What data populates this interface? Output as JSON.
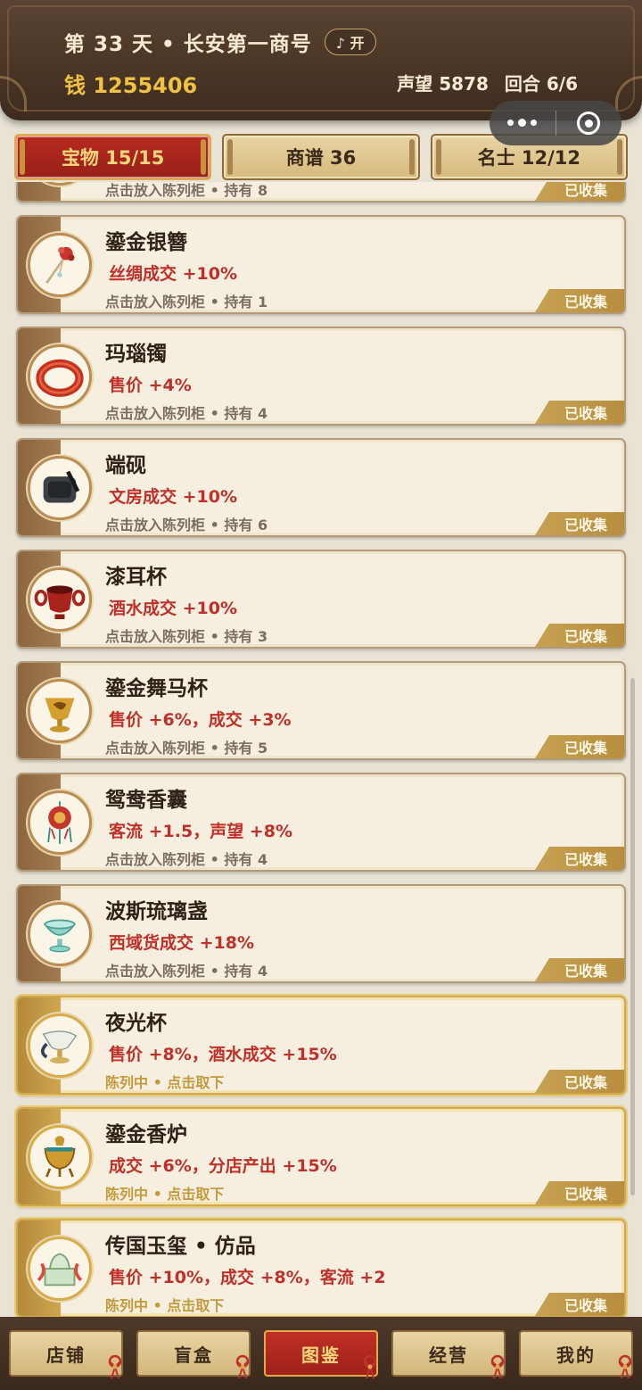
{
  "header": {
    "title": "第 33 天 • 长安第一商号",
    "music_label": "♪ 开",
    "money": "钱 1255406",
    "reputation": "声望 5878",
    "round": "回合 6/6"
  },
  "tabs": [
    {
      "label": "宝物 15/15",
      "active": true
    },
    {
      "label": "商谱 36",
      "active": false
    },
    {
      "label": "名士 12/12",
      "active": false
    }
  ],
  "collected_label": "已收集",
  "items": [
    {
      "name": "",
      "effect": "",
      "hint": "点击放入陈列柜 • 持有 8",
      "icon": "partial-item-icon",
      "displayed": false
    },
    {
      "name": "鎏金银簪",
      "effect": "丝绸成交 +10%",
      "hint": "点击放入陈列柜 • 持有 1",
      "icon": "hairpin-icon",
      "displayed": false
    },
    {
      "name": "玛瑙镯",
      "effect": "售价 +4%",
      "hint": "点击放入陈列柜 • 持有 4",
      "icon": "bracelet-icon",
      "displayed": false
    },
    {
      "name": "端砚",
      "effect": "文房成交 +10%",
      "hint": "点击放入陈列柜 • 持有 6",
      "icon": "inkstone-icon",
      "displayed": false
    },
    {
      "name": "漆耳杯",
      "effect": "酒水成交 +10%",
      "hint": "点击放入陈列柜 • 持有 3",
      "icon": "lacquer-cup-icon",
      "displayed": false
    },
    {
      "name": "鎏金舞马杯",
      "effect": "售价 +6%，成交 +3%",
      "hint": "点击放入陈列柜 • 持有 5",
      "icon": "gold-cup-icon",
      "displayed": false
    },
    {
      "name": "鸳鸯香囊",
      "effect": "客流 +1.5，声望 +8%",
      "hint": "点击放入陈列柜 • 持有 4",
      "icon": "sachet-icon",
      "displayed": false
    },
    {
      "name": "波斯琉璃盏",
      "effect": "西域货成交 +18%",
      "hint": "点击放入陈列柜 • 持有 4",
      "icon": "glass-bowl-icon",
      "displayed": false
    },
    {
      "name": "夜光杯",
      "effect": "售价 +8%，酒水成交 +15%",
      "hint": "陈列中 • 点击取下",
      "icon": "luminous-cup-icon",
      "displayed": true
    },
    {
      "name": "鎏金香炉",
      "effect": "成交 +6%，分店产出 +15%",
      "hint": "陈列中 • 点击取下",
      "icon": "censer-icon",
      "displayed": true
    },
    {
      "name": "传国玉玺 • 仿品",
      "effect": "售价 +10%，成交 +8%，客流 +2",
      "hint": "陈列中 • 点击取下",
      "icon": "jade-seal-icon",
      "displayed": true
    }
  ],
  "bottom_nav": [
    {
      "label": "店铺",
      "active": false
    },
    {
      "label": "盲盒",
      "active": false
    },
    {
      "label": "图鉴",
      "active": true
    },
    {
      "label": "经营",
      "active": false
    },
    {
      "label": "我的",
      "active": false
    }
  ],
  "colors": {
    "accent_red": "#c0302a",
    "gold": "#f0c244",
    "header_brown": "#4b3626"
  }
}
